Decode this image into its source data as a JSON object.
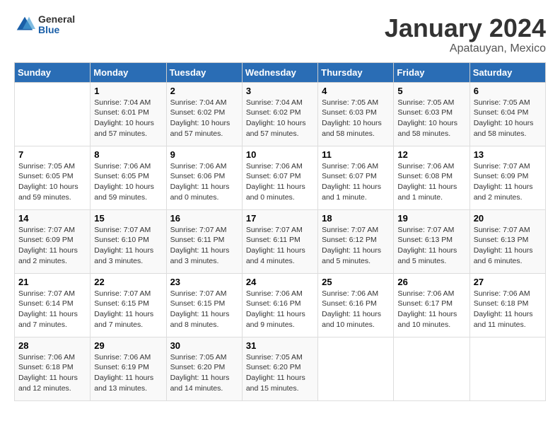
{
  "header": {
    "logo_general": "General",
    "logo_blue": "Blue",
    "month_title": "January 2024",
    "location": "Apatauyan, Mexico"
  },
  "days_of_week": [
    "Sunday",
    "Monday",
    "Tuesday",
    "Wednesday",
    "Thursday",
    "Friday",
    "Saturday"
  ],
  "weeks": [
    [
      {
        "day": "",
        "info": ""
      },
      {
        "day": "1",
        "info": "Sunrise: 7:04 AM\nSunset: 6:01 PM\nDaylight: 10 hours\nand 57 minutes."
      },
      {
        "day": "2",
        "info": "Sunrise: 7:04 AM\nSunset: 6:02 PM\nDaylight: 10 hours\nand 57 minutes."
      },
      {
        "day": "3",
        "info": "Sunrise: 7:04 AM\nSunset: 6:02 PM\nDaylight: 10 hours\nand 57 minutes."
      },
      {
        "day": "4",
        "info": "Sunrise: 7:05 AM\nSunset: 6:03 PM\nDaylight: 10 hours\nand 58 minutes."
      },
      {
        "day": "5",
        "info": "Sunrise: 7:05 AM\nSunset: 6:03 PM\nDaylight: 10 hours\nand 58 minutes."
      },
      {
        "day": "6",
        "info": "Sunrise: 7:05 AM\nSunset: 6:04 PM\nDaylight: 10 hours\nand 58 minutes."
      }
    ],
    [
      {
        "day": "7",
        "info": "Sunrise: 7:05 AM\nSunset: 6:05 PM\nDaylight: 10 hours\nand 59 minutes."
      },
      {
        "day": "8",
        "info": "Sunrise: 7:06 AM\nSunset: 6:05 PM\nDaylight: 10 hours\nand 59 minutes."
      },
      {
        "day": "9",
        "info": "Sunrise: 7:06 AM\nSunset: 6:06 PM\nDaylight: 11 hours\nand 0 minutes."
      },
      {
        "day": "10",
        "info": "Sunrise: 7:06 AM\nSunset: 6:07 PM\nDaylight: 11 hours\nand 0 minutes."
      },
      {
        "day": "11",
        "info": "Sunrise: 7:06 AM\nSunset: 6:07 PM\nDaylight: 11 hours\nand 1 minute."
      },
      {
        "day": "12",
        "info": "Sunrise: 7:06 AM\nSunset: 6:08 PM\nDaylight: 11 hours\nand 1 minute."
      },
      {
        "day": "13",
        "info": "Sunrise: 7:07 AM\nSunset: 6:09 PM\nDaylight: 11 hours\nand 2 minutes."
      }
    ],
    [
      {
        "day": "14",
        "info": "Sunrise: 7:07 AM\nSunset: 6:09 PM\nDaylight: 11 hours\nand 2 minutes."
      },
      {
        "day": "15",
        "info": "Sunrise: 7:07 AM\nSunset: 6:10 PM\nDaylight: 11 hours\nand 3 minutes."
      },
      {
        "day": "16",
        "info": "Sunrise: 7:07 AM\nSunset: 6:11 PM\nDaylight: 11 hours\nand 3 minutes."
      },
      {
        "day": "17",
        "info": "Sunrise: 7:07 AM\nSunset: 6:11 PM\nDaylight: 11 hours\nand 4 minutes."
      },
      {
        "day": "18",
        "info": "Sunrise: 7:07 AM\nSunset: 6:12 PM\nDaylight: 11 hours\nand 5 minutes."
      },
      {
        "day": "19",
        "info": "Sunrise: 7:07 AM\nSunset: 6:13 PM\nDaylight: 11 hours\nand 5 minutes."
      },
      {
        "day": "20",
        "info": "Sunrise: 7:07 AM\nSunset: 6:13 PM\nDaylight: 11 hours\nand 6 minutes."
      }
    ],
    [
      {
        "day": "21",
        "info": "Sunrise: 7:07 AM\nSunset: 6:14 PM\nDaylight: 11 hours\nand 7 minutes."
      },
      {
        "day": "22",
        "info": "Sunrise: 7:07 AM\nSunset: 6:15 PM\nDaylight: 11 hours\nand 7 minutes."
      },
      {
        "day": "23",
        "info": "Sunrise: 7:07 AM\nSunset: 6:15 PM\nDaylight: 11 hours\nand 8 minutes."
      },
      {
        "day": "24",
        "info": "Sunrise: 7:06 AM\nSunset: 6:16 PM\nDaylight: 11 hours\nand 9 minutes."
      },
      {
        "day": "25",
        "info": "Sunrise: 7:06 AM\nSunset: 6:16 PM\nDaylight: 11 hours\nand 10 minutes."
      },
      {
        "day": "26",
        "info": "Sunrise: 7:06 AM\nSunset: 6:17 PM\nDaylight: 11 hours\nand 10 minutes."
      },
      {
        "day": "27",
        "info": "Sunrise: 7:06 AM\nSunset: 6:18 PM\nDaylight: 11 hours\nand 11 minutes."
      }
    ],
    [
      {
        "day": "28",
        "info": "Sunrise: 7:06 AM\nSunset: 6:18 PM\nDaylight: 11 hours\nand 12 minutes."
      },
      {
        "day": "29",
        "info": "Sunrise: 7:06 AM\nSunset: 6:19 PM\nDaylight: 11 hours\nand 13 minutes."
      },
      {
        "day": "30",
        "info": "Sunrise: 7:05 AM\nSunset: 6:20 PM\nDaylight: 11 hours\nand 14 minutes."
      },
      {
        "day": "31",
        "info": "Sunrise: 7:05 AM\nSunset: 6:20 PM\nDaylight: 11 hours\nand 15 minutes."
      },
      {
        "day": "",
        "info": ""
      },
      {
        "day": "",
        "info": ""
      },
      {
        "day": "",
        "info": ""
      }
    ]
  ]
}
